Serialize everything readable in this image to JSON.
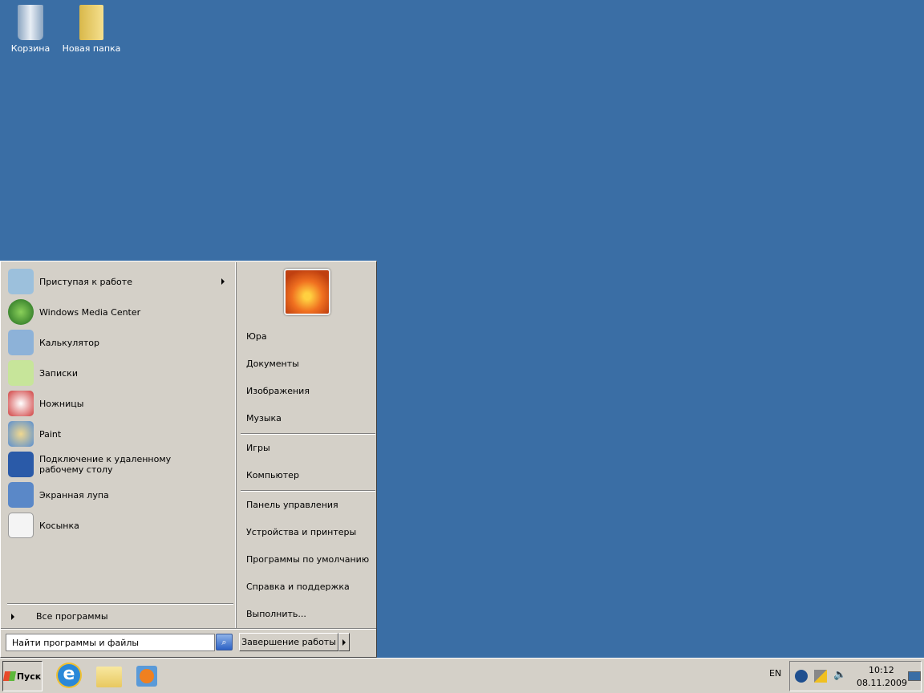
{
  "desktop": {
    "icons": [
      {
        "label": "Корзина"
      },
      {
        "label": "Новая папка"
      }
    ]
  },
  "start_menu": {
    "programs": [
      {
        "label": "Приступая к работе",
        "icon": "getting-started-icon",
        "submenu": true
      },
      {
        "label": "Windows Media Center",
        "icon": "media-center-icon"
      },
      {
        "label": "Калькулятор",
        "icon": "calculator-icon"
      },
      {
        "label": "Записки",
        "icon": "sticky-notes-icon"
      },
      {
        "label": "Ножницы",
        "icon": "snipping-tool-icon"
      },
      {
        "label": "Paint",
        "icon": "paint-icon"
      },
      {
        "label": "Подключение к удаленному рабочему столу",
        "icon": "remote-desktop-icon"
      },
      {
        "label": "Экранная лупа",
        "icon": "magnifier-icon"
      },
      {
        "label": "Косынка",
        "icon": "solitaire-icon"
      }
    ],
    "all_programs": "Все программы",
    "search_placeholder": "Найти программы и файлы",
    "right": [
      "Юра",
      "Документы",
      "Изображения",
      "Музыка",
      "Игры",
      "Компьютер",
      "Панель управления",
      "Устройства и принтеры",
      "Программы по умолчанию",
      "Справка и поддержка",
      "Выполнить..."
    ],
    "shutdown": "Завершение работы"
  },
  "taskbar": {
    "start": "Пуск",
    "lang": "EN",
    "time": "10:12",
    "date": "08.11.2009"
  }
}
